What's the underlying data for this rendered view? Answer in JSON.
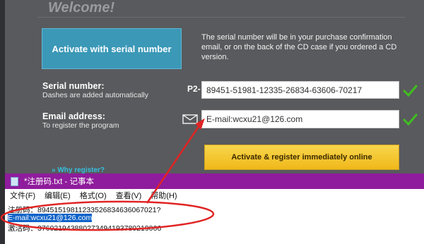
{
  "app": {
    "welcome": "Welcome!",
    "activate_serial_label": "Activate with serial number",
    "serial_info": "The serial number will be in your purchase confirmation email, or on the back of the CD case if you ordered a CD version.",
    "serial_label": "Serial number:",
    "serial_sub": "Dashes are added automatically",
    "serial_prefix": "P2-",
    "serial_value": "89451-51981-12335-26834-63606-70217",
    "email_label": "Email address:",
    "email_sub": "To register the program",
    "email_value": "E-mail:wcxu21@126.com",
    "register_button": "Activate & register immediately online",
    "why_register": "Why register?",
    "colors": {
      "background": "#595a5d",
      "accent": "#3b98b7",
      "button": "#f0b81a",
      "check": "#3fbf1f"
    }
  },
  "notepad": {
    "title": "*注册码.txt - 记事本",
    "menu": [
      "文件(F)",
      "编辑(E)",
      "格式(O)",
      "查看(V)",
      "帮助(H)"
    ],
    "lines": {
      "line1": "注册码：89451519811233526834636067021?",
      "line2": "E-mail:wcxu21@126.com",
      "line3": "激活码：37602194388027349419378021906­6"
    },
    "title_color": "#8f1c9c"
  },
  "annotation": {
    "color": "#e02424"
  }
}
